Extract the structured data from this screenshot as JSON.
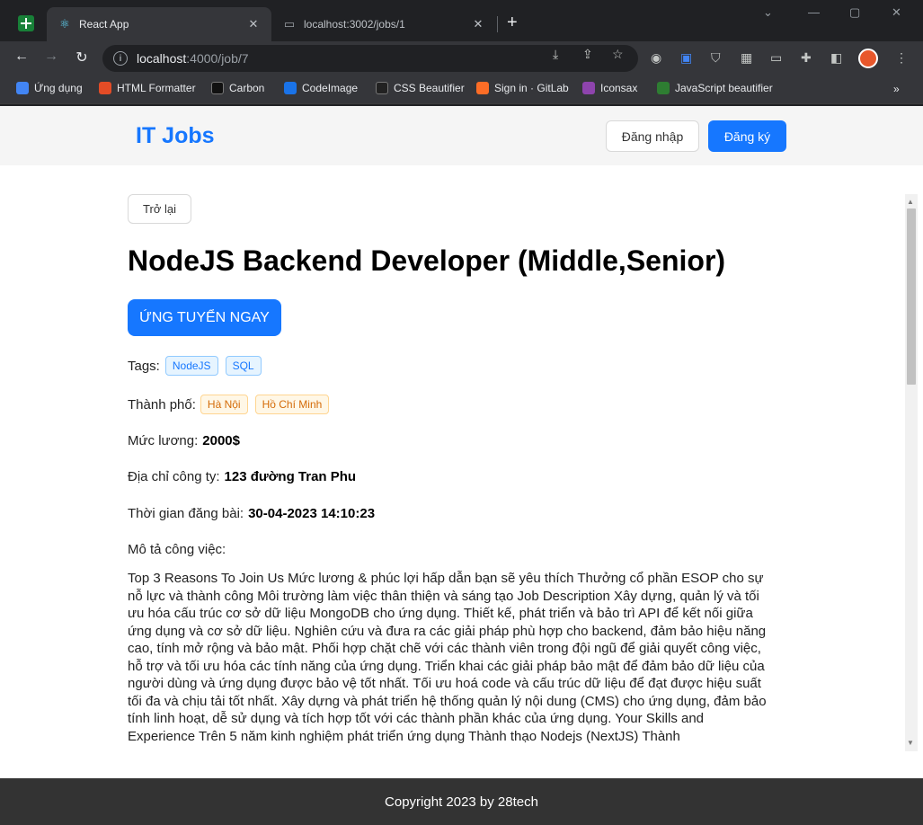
{
  "browser": {
    "tabs": [
      {
        "title": "React App",
        "icon": "react-icon"
      },
      {
        "title": "localhost:3002/jobs/1",
        "icon": "page-icon"
      }
    ],
    "url_host": "localhost",
    "url_path": ":4000/job/7",
    "bookmarks": [
      {
        "label": "Ứng dụng",
        "color": "#4285f4"
      },
      {
        "label": "HTML Formatter",
        "color": "#e34c26"
      },
      {
        "label": "Carbon",
        "color": "#111111"
      },
      {
        "label": "CodeImage",
        "color": "#1a73e8"
      },
      {
        "label": "CSS Beautifier",
        "color": "#222222"
      },
      {
        "label": "Sign in · GitLab",
        "color": "#fc6d26"
      },
      {
        "label": "Iconsax",
        "color": "#8e44ad"
      },
      {
        "label": "JavaScript beautifier",
        "color": "#2e7d32"
      }
    ],
    "bookmarks_more": "»"
  },
  "header": {
    "logo": "IT Jobs",
    "login_label": "Đăng nhập",
    "register_label": "Đăng ký"
  },
  "job": {
    "back_label": "Trở lại",
    "title": "NodeJS Backend Developer (Middle,Senior)",
    "apply_label": "ỨNG TUYỂN NGAY",
    "tags_label": "Tags:",
    "tags": [
      "NodeJS",
      "SQL"
    ],
    "city_label": "Thành phố:",
    "cities": [
      "Hà Nội",
      "Hồ Chí Minh"
    ],
    "salary_label": "Mức lương:",
    "salary": "2000$",
    "address_label": "Địa chỉ công ty:",
    "address": "123 đường Tran Phu",
    "posted_label": "Thời gian đăng bài:",
    "posted": "30-04-2023 14:10:23",
    "description_label": "Mô tả công việc:",
    "description": "Top 3 Reasons To Join Us Mức lương & phúc lợi hấp dẫn bạn sẽ yêu thích Thưởng cổ phần ESOP cho sự nỗ lực và thành công Môi trường làm việc thân thiện và sáng tạo Job Description Xây dựng, quản lý và tối ưu hóa cấu trúc cơ sở dữ liệu MongoDB cho ứng dụng. Thiết kế, phát triển và bảo trì API để kết nối giữa ứng dụng và cơ sở dữ liệu. Nghiên cứu và đưa ra các giải pháp phù hợp cho backend, đảm bảo hiệu năng cao, tính mở rộng và bảo mật. Phối hợp chặt chẽ với các thành viên trong đội ngũ để giải quyết công việc, hỗ trợ và tối ưu hóa các tính năng của ứng dụng. Triển khai các giải pháp bảo mật để đảm bảo dữ liệu của người dùng và ứng dụng được bảo vệ tốt nhất. Tối ưu hoá code và cấu trúc dữ liệu để đạt được hiệu suất tối đa và chịu tải tốt nhất. Xây dựng và phát triển hệ thống quản lý nội dung (CMS) cho ứng dụng, đảm bảo tính linh hoạt, dễ sử dụng và tích hợp tốt với các thành phần khác của ứng dụng. Your Skills and Experience Trên 5 năm kinh nghiệm phát triển ứng dụng Thành thạo Nodejs (NextJS) Thành"
  },
  "footer": {
    "copyright": "Copyright 2023 by 28tech"
  },
  "colors": {
    "primary": "#1677ff",
    "footer_bg": "#333333"
  }
}
